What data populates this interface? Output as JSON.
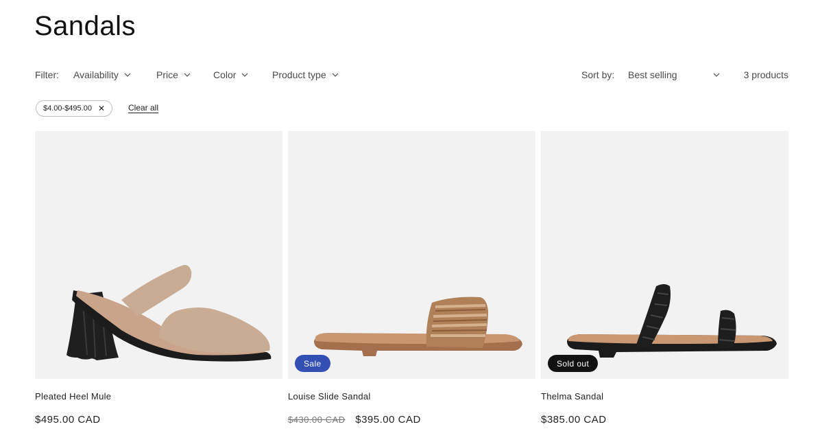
{
  "collection": {
    "title": "Sandals"
  },
  "filters": {
    "label": "Filter:",
    "items": [
      {
        "label": "Availability",
        "icon": "chevron-down-icon"
      },
      {
        "label": "Price",
        "icon": "chevron-down-icon"
      },
      {
        "label": "Color",
        "icon": "chevron-down-icon"
      },
      {
        "label": "Product type",
        "icon": "chevron-down-icon"
      }
    ],
    "active": [
      {
        "label": "$4.00-$495.00",
        "icon": "close-icon"
      }
    ],
    "clear_all": "Clear all"
  },
  "sort": {
    "label": "Sort by:",
    "value": "Best selling",
    "icon": "chevron-down-icon"
  },
  "count": "3 products",
  "products": [
    {
      "name": "Pleated Heel Mule",
      "price": "$495.00 CAD",
      "compare_price": "",
      "badge": ""
    },
    {
      "name": "Louise Slide Sandal",
      "price": "$395.00 CAD",
      "compare_price": "$430.00 CAD",
      "badge": "Sale",
      "badge_color": "#334fb4"
    },
    {
      "name": "Thelma Sandal",
      "price": "$385.00 CAD",
      "compare_price": "",
      "badge": "Sold out",
      "badge_color": "#121212"
    }
  ],
  "colors": {
    "image_bg": "#f2f2f2",
    "text": "#121212",
    "sale": "#334fb4"
  }
}
